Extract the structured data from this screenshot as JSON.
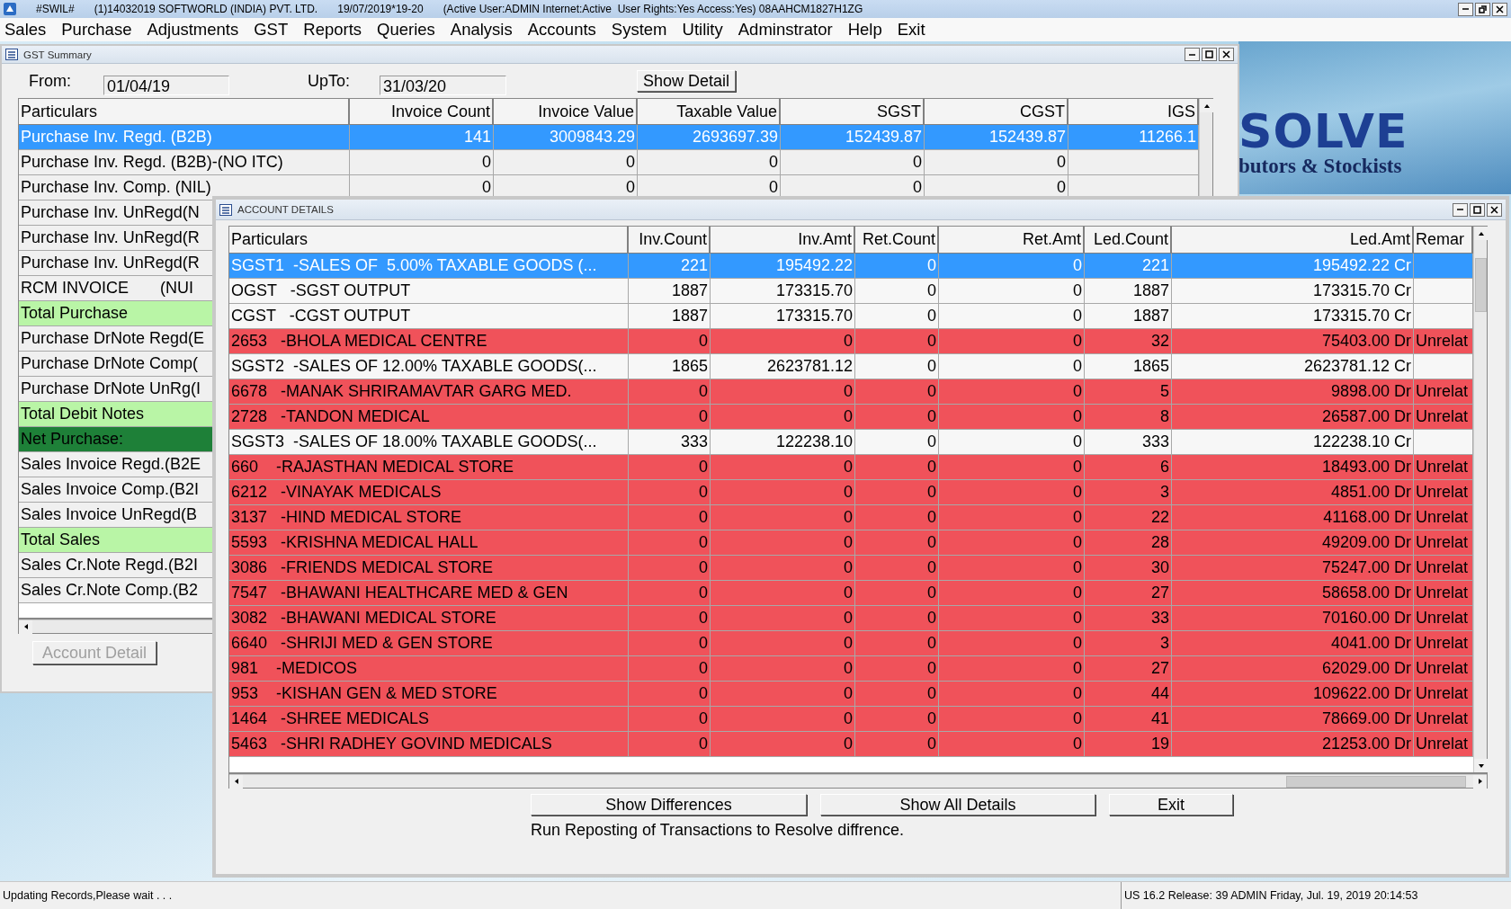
{
  "app_title_bar": {
    "segments": [
      "#SWIL#",
      "(1)14032019 SOFTWORLD (INDIA) PVT. LTD.",
      "19/07/2019*19-20",
      "(Active User:ADMIN Internet:Active  User Rights:Yes Access:Yes) 08AAHCM1827H1ZG"
    ]
  },
  "menu": [
    "Sales",
    "Purchase",
    "Adjustments",
    "GST",
    "Reports",
    "Queries",
    "Analysis",
    "Accounts",
    "System",
    "Utility",
    "Adminstrator",
    "Help",
    "Exit"
  ],
  "logo": {
    "name": "SOLVE",
    "tagline": "butors & Stockists"
  },
  "gst_summary": {
    "title": "GST Summary",
    "from_label": "From:",
    "from_value": "01/04/19",
    "upto_label": "UpTo:",
    "upto_value": "31/03/20",
    "show_detail_button": "Show Detail",
    "columns": [
      "Particulars",
      "Invoice Count",
      "Invoice Value",
      "Taxable Value",
      "SGST",
      "CGST",
      "IGS"
    ],
    "rows": [
      {
        "kind": "normal",
        "selected": true,
        "cells": [
          "Purchase Inv. Regd. (B2B)",
          "141",
          "3009843.29",
          "2693697.39",
          "152439.87",
          "152439.87",
          "11266.1"
        ]
      },
      {
        "kind": "normal",
        "selected": false,
        "cells": [
          "Purchase Inv. Regd. (B2B)-(NO ITC)",
          "0",
          "0",
          "0",
          "0",
          "0"
        ]
      },
      {
        "kind": "normal",
        "selected": false,
        "cells": [
          "Purchase Inv. Comp. (NIL)",
          "0",
          "0",
          "0",
          "0",
          "0"
        ]
      },
      {
        "kind": "normal",
        "selected": false,
        "cells": [
          "Purchase Inv. UnRegd(N"
        ]
      },
      {
        "kind": "normal",
        "selected": false,
        "cells": [
          "Purchase Inv. UnRegd(R"
        ]
      },
      {
        "kind": "normal",
        "selected": false,
        "cells": [
          "Purchase Inv. UnRegd(R"
        ]
      },
      {
        "kind": "normal",
        "selected": false,
        "cells": [
          "RCM INVOICE       (NUI"
        ]
      },
      {
        "kind": "total",
        "selected": false,
        "cells": [
          "Total Purchase"
        ]
      },
      {
        "kind": "normal",
        "selected": false,
        "cells": [
          "Purchase DrNote Regd(E"
        ]
      },
      {
        "kind": "normal",
        "selected": false,
        "cells": [
          "Purchase DrNote Comp("
        ]
      },
      {
        "kind": "normal",
        "selected": false,
        "cells": [
          "Purchase DrNote UnRg(I"
        ]
      },
      {
        "kind": "total",
        "selected": false,
        "cells": [
          "Total Debit Notes"
        ]
      },
      {
        "kind": "net",
        "selected": false,
        "cells": [
          "Net Purchase:"
        ]
      },
      {
        "kind": "normal",
        "selected": false,
        "cells": [
          "Sales Invoice Regd.(B2E"
        ]
      },
      {
        "kind": "normal",
        "selected": false,
        "cells": [
          "Sales Invoice Comp.(B2I"
        ]
      },
      {
        "kind": "normal",
        "selected": false,
        "cells": [
          "Sales Invoice UnRegd(B"
        ]
      },
      {
        "kind": "total",
        "selected": false,
        "cells": [
          "Total Sales"
        ]
      },
      {
        "kind": "normal",
        "selected": false,
        "cells": [
          "Sales Cr.Note Regd.(B2I"
        ]
      },
      {
        "kind": "normal",
        "selected": false,
        "cells": [
          "Sales Cr.Note Comp.(B2"
        ]
      }
    ],
    "account_detail_button": {
      "label": "Account Detail",
      "disabled": true
    }
  },
  "account_details": {
    "title": "ACCOUNT DETAILS",
    "columns": [
      "Particulars",
      "Inv.Count",
      "Inv.Amt",
      "Ret.Count",
      "Ret.Amt",
      "Led.Count",
      "Led.Amt",
      "Remar"
    ],
    "rows": [
      {
        "kind": "matched",
        "selected": true,
        "cells": [
          "SGST1  -SALES OF  5.00% TAXABLE GOODS (...",
          "221",
          "195492.22",
          "0",
          "0",
          "221",
          "195492.22 Cr"
        ]
      },
      {
        "kind": "matched",
        "selected": false,
        "cells": [
          "OGST   -SGST OUTPUT",
          "1887",
          "173315.70",
          "0",
          "0",
          "1887",
          "173315.70 Cr"
        ]
      },
      {
        "kind": "matched",
        "selected": false,
        "cells": [
          "CGST   -CGST OUTPUT",
          "1887",
          "173315.70",
          "0",
          "0",
          "1887",
          "173315.70 Cr"
        ]
      },
      {
        "kind": "mismatch",
        "selected": false,
        "cells": [
          "2653   -BHOLA MEDICAL CENTRE",
          "0",
          "0",
          "0",
          "0",
          "32",
          "75403.00 Dr",
          "Unrelat"
        ]
      },
      {
        "kind": "matched",
        "selected": false,
        "cells": [
          "SGST2  -SALES OF 12.00% TAXABLE GOODS(...",
          "1865",
          "2623781.12",
          "0",
          "0",
          "1865",
          "2623781.12 Cr"
        ]
      },
      {
        "kind": "mismatch",
        "selected": false,
        "cells": [
          "6678   -MANAK SHRIRAMAVTAR GARG MED.",
          "0",
          "0",
          "0",
          "0",
          "5",
          "9898.00 Dr",
          "Unrelat"
        ]
      },
      {
        "kind": "mismatch",
        "selected": false,
        "cells": [
          "2728   -TANDON MEDICAL",
          "0",
          "0",
          "0",
          "0",
          "8",
          "26587.00 Dr",
          "Unrelat"
        ]
      },
      {
        "kind": "matched",
        "selected": false,
        "cells": [
          "SGST3  -SALES OF 18.00% TAXABLE GOODS(...",
          "333",
          "122238.10",
          "0",
          "0",
          "333",
          "122238.10 Cr"
        ]
      },
      {
        "kind": "mismatch",
        "selected": false,
        "cells": [
          "660    -RAJASTHAN MEDICAL STORE",
          "0",
          "0",
          "0",
          "0",
          "6",
          "18493.00 Dr",
          "Unrelat"
        ]
      },
      {
        "kind": "mismatch",
        "selected": false,
        "cells": [
          "6212   -VINAYAK MEDICALS",
          "0",
          "0",
          "0",
          "0",
          "3",
          "4851.00 Dr",
          "Unrelat"
        ]
      },
      {
        "kind": "mismatch",
        "selected": false,
        "cells": [
          "3137   -HIND MEDICAL STORE",
          "0",
          "0",
          "0",
          "0",
          "22",
          "41168.00 Dr",
          "Unrelat"
        ]
      },
      {
        "kind": "mismatch",
        "selected": false,
        "cells": [
          "5593   -KRISHNA MEDICAL HALL",
          "0",
          "0",
          "0",
          "0",
          "28",
          "49209.00 Dr",
          "Unrelat"
        ]
      },
      {
        "kind": "mismatch",
        "selected": false,
        "cells": [
          "3086   -FRIENDS MEDICAL STORE",
          "0",
          "0",
          "0",
          "0",
          "30",
          "75247.00 Dr",
          "Unrelat"
        ]
      },
      {
        "kind": "mismatch",
        "selected": false,
        "cells": [
          "7547   -BHAWANI HEALTHCARE MED & GEN",
          "0",
          "0",
          "0",
          "0",
          "27",
          "58658.00 Dr",
          "Unrelat"
        ]
      },
      {
        "kind": "mismatch",
        "selected": false,
        "cells": [
          "3082   -BHAWANI MEDICAL STORE",
          "0",
          "0",
          "0",
          "0",
          "33",
          "70160.00 Dr",
          "Unrelat"
        ]
      },
      {
        "kind": "mismatch",
        "selected": false,
        "cells": [
          "6640   -SHRIJI MED & GEN STORE",
          "0",
          "0",
          "0",
          "0",
          "3",
          "4041.00 Dr",
          "Unrelat"
        ]
      },
      {
        "kind": "mismatch",
        "selected": false,
        "cells": [
          "981    -MEDICOS",
          "0",
          "0",
          "0",
          "0",
          "27",
          "62029.00 Dr",
          "Unrelat"
        ]
      },
      {
        "kind": "mismatch",
        "selected": false,
        "cells": [
          "953    -KISHAN GEN & MED STORE",
          "0",
          "0",
          "0",
          "0",
          "44",
          "109622.00 Dr",
          "Unrelat"
        ]
      },
      {
        "kind": "mismatch",
        "selected": false,
        "cells": [
          "1464   -SHREE MEDICALS",
          "0",
          "0",
          "0",
          "0",
          "41",
          "78669.00 Dr",
          "Unrelat"
        ]
      },
      {
        "kind": "mismatch",
        "selected": false,
        "cells": [
          "5463   -SHRI RADHEY GOVIND MEDICALS",
          "0",
          "0",
          "0",
          "0",
          "19",
          "21253.00 Dr",
          "Unrelat"
        ]
      }
    ],
    "buttons": [
      "Show Differences",
      "Show All Details",
      "Exit"
    ],
    "message": "Run Reposting of Transactions to Resolve diffrence."
  },
  "status_bar": {
    "left": "Updating Records,Please wait . . .",
    "right": "US 16.2 Release: 39 ADMIN  Friday, Jul. 19, 2019  20:14:53"
  }
}
